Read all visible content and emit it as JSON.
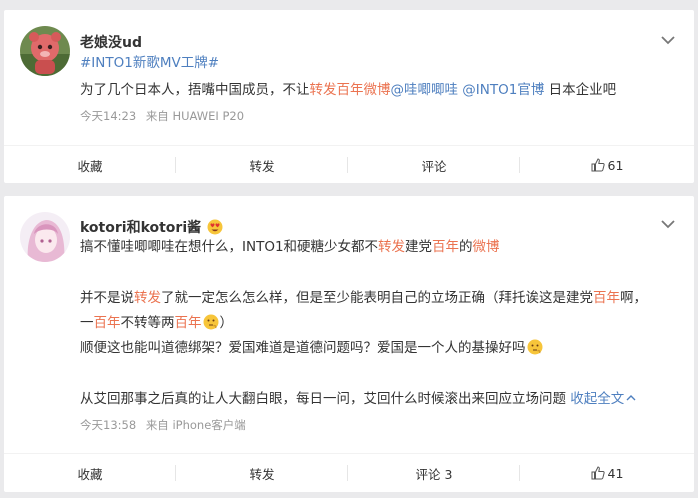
{
  "posts": [
    {
      "username": "老娘没ud",
      "hashtag": "#INTO1新歌MV工牌#",
      "text_segments": [
        {
          "text": "为了几个日本人，捂嘴中国成员，不让",
          "style": "plain"
        },
        {
          "text": "转发百年微博",
          "style": "red"
        },
        {
          "text": "@哇唧唧哇",
          "style": "blue"
        },
        {
          "text": " ",
          "style": "plain"
        },
        {
          "text": "@INTO1官博",
          "style": "blue"
        },
        {
          "text": " 日本企业吧",
          "style": "plain"
        }
      ],
      "time": "今天14:23",
      "source": "来自 HUAWEI P20",
      "actions": {
        "favorite": "收藏",
        "repost": "转发",
        "comment": "评论",
        "like_count": "61"
      }
    },
    {
      "username": "kotori和kotori酱",
      "username_emoji": "heart-eyes-emoji",
      "lines": [
        [
          {
            "text": "搞不懂哇唧唧哇在想什么，INTO1和硬糖少女都不",
            "style": "plain"
          },
          {
            "text": "转发",
            "style": "red"
          },
          {
            "text": "建党",
            "style": "plain"
          },
          {
            "text": "百年",
            "style": "red"
          },
          {
            "text": "的",
            "style": "plain"
          },
          {
            "text": "微博",
            "style": "red"
          }
        ],
        [
          {
            "text": "并不是说",
            "style": "plain"
          },
          {
            "text": "转发",
            "style": "red"
          },
          {
            "text": "了就一定怎么怎么样，但是至少能表明自己的立场正确（拜托诶这是建党",
            "style": "plain"
          },
          {
            "text": "百年",
            "style": "red"
          },
          {
            "text": "啊，",
            "style": "plain"
          }
        ],
        [
          {
            "text": "一",
            "style": "plain"
          },
          {
            "text": "百年",
            "style": "red"
          },
          {
            "text": "不转等两",
            "style": "plain"
          },
          {
            "text": "百年",
            "style": "red"
          }
        ],
        [
          {
            "text": "顺便这也能叫道德绑架？爱国难道是道德问题吗？爱国是一个人的基操好吗",
            "style": "plain"
          }
        ],
        [
          {
            "text": "从艾回那事之后真的让人大翻白眼，每日一问，艾回什么时候滚出来回应立场问题",
            "style": "plain"
          }
        ]
      ],
      "line3_tail": "）",
      "fold_label": "收起全文",
      "time": "今天13:58",
      "source": "来自 iPhone客户端",
      "actions": {
        "favorite": "收藏",
        "repost": "转发",
        "comment": "评论 3",
        "like_count": "41"
      }
    }
  ],
  "colors": {
    "highlight_red": "#eb7350",
    "link_blue": "#4e7fbf",
    "meta_gray": "#999999"
  }
}
